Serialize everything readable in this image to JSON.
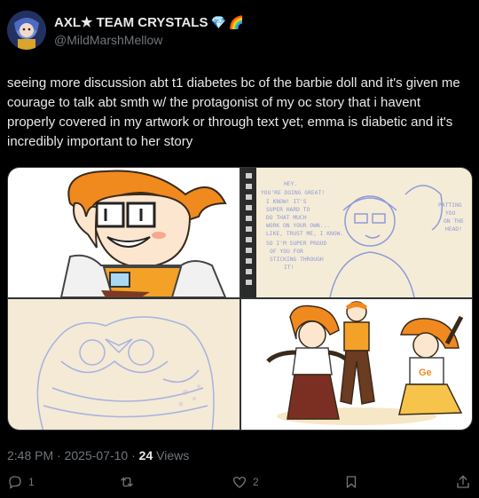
{
  "author": {
    "display_name": "AXL★ TEAM CRYSTALS",
    "emojis": [
      "💎",
      "🌈"
    ],
    "handle": "@MildMarshMellow"
  },
  "post": {
    "text": "seeing more discussion abt t1 diabetes bc of the barbie doll and it's given me courage to talk abt smth w/ the protagonist of my oc story that i havent properly covered in my artwork or through text yet; emma is diabetic and it's incredibly important to her story"
  },
  "comic_text": {
    "speech": "HEY. YOU'RE DOING GREAT! I KNOW! IT'S SUPER HARD TO DO THAT MUCH WORK ON YOUR OWN... LIKE, TRUST ME, I KNOW. SO I'M SUPER PROUD OF YOU FOR STICKING THROUGH IT!",
    "side_note": "PATTING YOU ON THE HEAD!"
  },
  "meta": {
    "time": "2:48 PM",
    "date": "2025-07-10",
    "views_count": "24",
    "views_label": "Views"
  },
  "actions": {
    "replies": "1",
    "reposts": "",
    "likes": "2"
  },
  "colors": {
    "accent": "#1d9bf0",
    "text": "#e7e9ea",
    "muted": "#71767b",
    "hair_orange": "#f08a1e",
    "sketch_blue": "#8f9bd6"
  }
}
